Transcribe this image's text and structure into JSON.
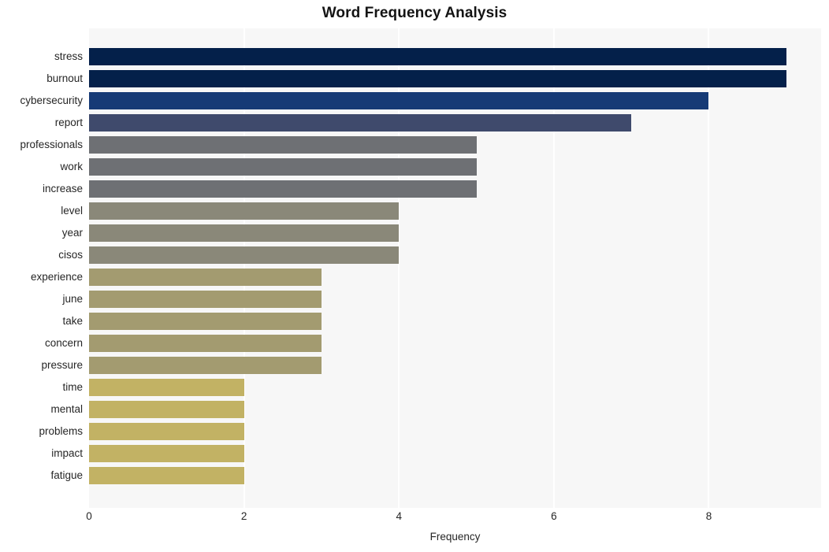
{
  "chart_data": {
    "type": "bar",
    "orientation": "horizontal",
    "title": "Word Frequency Analysis",
    "xlabel": "Frequency",
    "ylabel": "",
    "xlim": [
      0,
      9.45
    ],
    "xticks": [
      0,
      2,
      4,
      6,
      8
    ],
    "xticklabels": [
      "0",
      "2",
      "4",
      "6",
      "8"
    ],
    "grid": "vertical-only",
    "legend": "none",
    "plot_background": "#f7f7f7",
    "gridline_color": "#ffffff",
    "categories": [
      "stress",
      "burnout",
      "cybersecurity",
      "report",
      "professionals",
      "work",
      "increase",
      "level",
      "year",
      "cisos",
      "experience",
      "june",
      "take",
      "concern",
      "pressure",
      "time",
      "mental",
      "problems",
      "impact",
      "fatigue"
    ],
    "values": [
      9,
      9,
      8,
      7,
      5,
      5,
      5,
      4,
      4,
      4,
      3,
      3,
      3,
      3,
      3,
      2,
      2,
      2,
      2,
      2
    ],
    "colors": [
      "#04204a",
      "#04204a",
      "#163a76",
      "#3f4a6c",
      "#6e7074",
      "#6e7074",
      "#6e7074",
      "#8a8879",
      "#8a8879",
      "#8a8879",
      "#a39b70",
      "#a39b70",
      "#a39b70",
      "#a39b70",
      "#a39b70",
      "#c2b264",
      "#c2b264",
      "#c2b264",
      "#c2b264",
      "#c2b264"
    ]
  }
}
